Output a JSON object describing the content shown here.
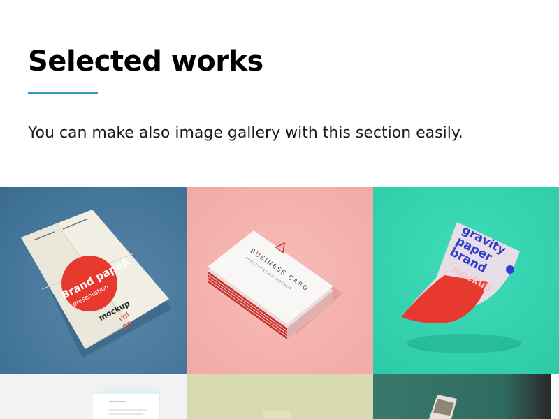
{
  "section": {
    "title": "Selected works",
    "description": "You can make also image gallery with this section easily."
  },
  "gallery": {
    "items": [
      {
        "name": "brand-paper-mockup",
        "text": {
          "line1": "Brand papeR",
          "line2": "presentation",
          "line3": "mockup",
          "line4": "vol",
          "line5": "05"
        }
      },
      {
        "name": "business-card-mockup",
        "text": {
          "line1": "BUSINESS CARD",
          "line2": "PRESENTATION MOCKUP"
        }
      },
      {
        "name": "gravity-paper-brand-mockup",
        "text": {
          "line1": "gravity",
          "line2": "paper",
          "line3": "brand",
          "line4": "mockup"
        }
      },
      {
        "name": "letterhead-mockup"
      },
      {
        "name": "green-background-mockup"
      },
      {
        "name": "photo-print-mockup"
      }
    ]
  },
  "colors": {
    "accent": "#3a93cc",
    "tile1_bg": "#43759a",
    "tile2_bg": "#f2aaa5",
    "tile3_bg": "#2ccaa7",
    "mockup_red": "#e8392f",
    "mockup_blue": "#2f3ecc"
  }
}
